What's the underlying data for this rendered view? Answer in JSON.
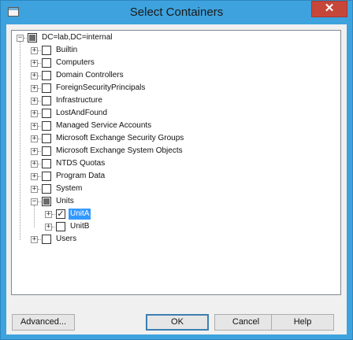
{
  "window": {
    "title": "Select Containers",
    "close_glyph": "✕"
  },
  "tree": {
    "root": {
      "label": "DC=lab,DC=internal",
      "state": "partial",
      "expander": "−"
    },
    "children": [
      {
        "label": "Builtin",
        "state": "unchecked",
        "expander": "+"
      },
      {
        "label": "Computers",
        "state": "unchecked",
        "expander": "+"
      },
      {
        "label": "Domain Controllers",
        "state": "unchecked",
        "expander": "+"
      },
      {
        "label": "ForeignSecurityPrincipals",
        "state": "unchecked",
        "expander": "+"
      },
      {
        "label": "Infrastructure",
        "state": "unchecked",
        "expander": "+"
      },
      {
        "label": "LostAndFound",
        "state": "unchecked",
        "expander": "+"
      },
      {
        "label": "Managed Service Accounts",
        "state": "unchecked",
        "expander": "+"
      },
      {
        "label": "Microsoft Exchange Security Groups",
        "state": "unchecked",
        "expander": "+"
      },
      {
        "label": "Microsoft Exchange System Objects",
        "state": "unchecked",
        "expander": "+"
      },
      {
        "label": "NTDS Quotas",
        "state": "unchecked",
        "expander": "+"
      },
      {
        "label": "Program Data",
        "state": "unchecked",
        "expander": "+"
      },
      {
        "label": "System",
        "state": "unchecked",
        "expander": "+"
      },
      {
        "label": "Units",
        "state": "partial",
        "expander": "−",
        "children": [
          {
            "label": "UnitA",
            "state": "checked",
            "expander": "+",
            "selected": true
          },
          {
            "label": "UnitB",
            "state": "unchecked",
            "expander": "+"
          }
        ]
      },
      {
        "label": "Users",
        "state": "unchecked",
        "expander": "+"
      }
    ],
    "check_glyph": "✓"
  },
  "buttons": {
    "advanced": "Advanced...",
    "ok": "OK",
    "cancel": "Cancel",
    "help": "Help"
  },
  "colors": {
    "title_bar": "#3da2dd",
    "close_button": "#c7463a",
    "selection": "#3399ff"
  }
}
